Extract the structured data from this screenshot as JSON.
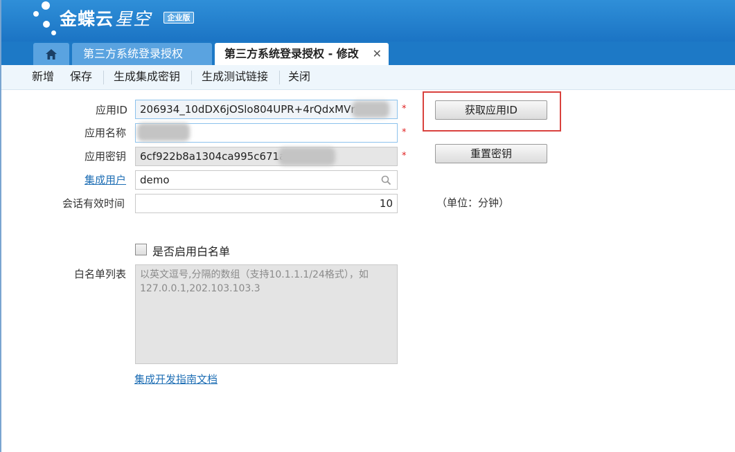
{
  "header": {
    "logo_bold": "金蝶云",
    "logo_light": "星空",
    "edition_badge": "企业版"
  },
  "tabs": [
    {
      "label": "第三方系统登录授权"
    },
    {
      "label": "第三方系统登录授权 - 修改"
    }
  ],
  "toolbar": {
    "new_label": "新增",
    "save_label": "保存",
    "gen_key_label": "生成集成密钥",
    "gen_link_label": "生成测试链接",
    "close_label": "关闭"
  },
  "form": {
    "app_id_label": "应用ID",
    "app_id_value": "206934_10dDX6jOSlo804UPR+4rQdxMVr",
    "app_name_label": "应用名称",
    "app_secret_label": "应用密钥",
    "app_secret_value": "6cf922b8a1304ca995c671a",
    "user_label": "集成用户",
    "user_value": "demo",
    "session_label": "会话有效时间",
    "session_value": "10",
    "session_unit": "（单位：分钟）",
    "required_mark": "*",
    "whitelist_enable_label": "是否启用白名单",
    "whitelist_label": "白名单列表",
    "whitelist_placeholder": "以英文逗号,分隔的数组（支持10.1.1.1/24格式），如127.0.0.1,202.103.103.3",
    "doc_link": "集成开发指南文档"
  },
  "buttons": {
    "get_app_id": "获取应用ID",
    "reset_secret": "重置密钥"
  }
}
